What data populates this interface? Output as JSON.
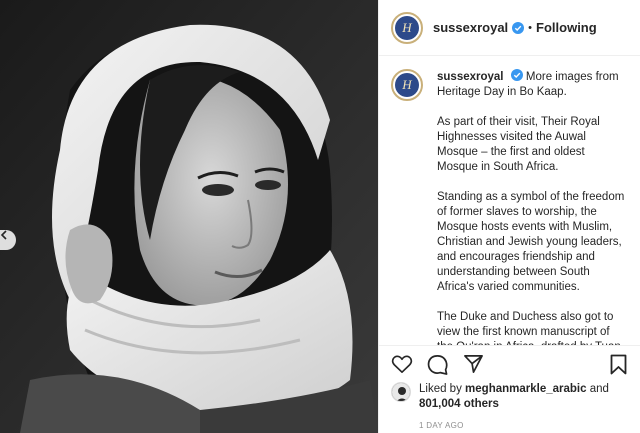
{
  "post": {
    "photo_alt": "black-and-white portrait of a woman wearing a white headscarf"
  },
  "header": {
    "username": "sussexroyal",
    "separator": "•",
    "follow_status": "Following",
    "avatar_monogram": "H"
  },
  "caption": {
    "username": "sussexroyal",
    "lead": "More images from Heritage Day in Bo Kaap.",
    "paragraphs": [
      "As part of their visit, Their Royal Highnesses visited the Auwal Mosque – the first and oldest Mosque in South Africa.",
      "Standing as a symbol of the freedom of former slaves to worship, the Mosque hosts events with Muslim, Christian and Jewish young leaders, and encourages friendship and understanding between South Africa's varied communities.",
      "The Duke and Duchess also got to view the first known manuscript of the Qu'ran in Africa, drafted by Tuan Guru"
    ]
  },
  "engagement": {
    "liked_by_prefix": "Liked by",
    "liked_by_user": "meghanmarkle_arabic",
    "and": "and",
    "others_count": "801,004 others",
    "timestamp": "1 DAY AGO"
  },
  "icons": {
    "like": "heart-icon",
    "comment": "comment-icon",
    "share": "share-icon",
    "save": "bookmark-icon",
    "verified": "verified-badge-icon",
    "carousel_prev": "chevron-left-icon"
  },
  "colors": {
    "verified_blue": "#3897f0",
    "avatar_ring": "#c9b07a",
    "avatar_fill": "#2d4a8a"
  }
}
